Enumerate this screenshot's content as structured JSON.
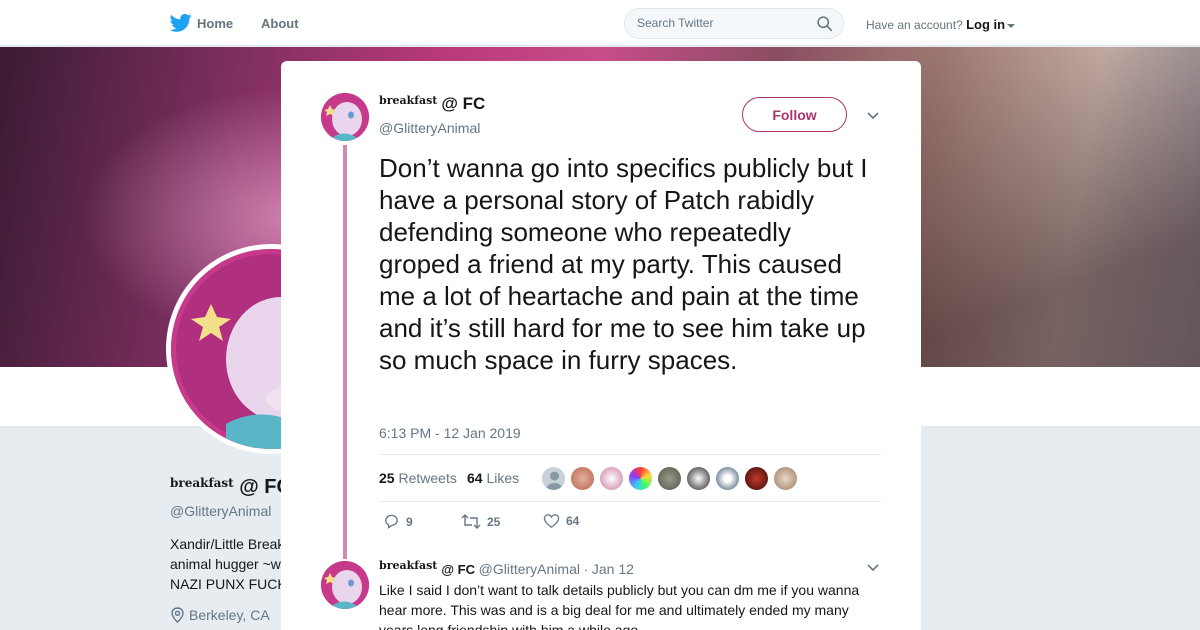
{
  "nav": {
    "home_label": "Home",
    "about_label": "About",
    "search_placeholder": "Search Twitter",
    "account_prompt": "Have an account?",
    "login_label": "Log in"
  },
  "profile": {
    "name_prefix": "breakfast",
    "name_main": "@ FC",
    "handle": "@GlitteryAnimal",
    "bio_lines": [
      "Xandir/Little Break",
      "animal hugger ~w",
      "NAZI PUNX FUCK"
    ],
    "location": "Berkeley, CA"
  },
  "tweet": {
    "name_prefix": "breakfast",
    "name_main": "@ FC",
    "handle": "@GlitteryAnimal",
    "follow_label": "Follow",
    "text": "Don’t wanna go into specifics publicly but I have a personal story of Patch rabidly defending someone who repeatedly groped a friend at my party. This caused me a lot of heartache and pain at the time and it’s still hard for me to see him take up so much space in furry spaces.",
    "timestamp": "6:13 PM - 12 Jan 2019",
    "retweets_count": "25",
    "retweets_label": "Retweets",
    "likes_count": "64",
    "likes_label": "Likes",
    "actions": {
      "replies": "9",
      "retweets": "25",
      "likes": "64"
    }
  },
  "reply": {
    "name_prefix": "breakfast",
    "name_main": "@ FC",
    "handle": "@GlitteryAnimal",
    "separator": "·",
    "date": "Jan 12",
    "text": "Like I said I don’t want to talk details publicly but you can dm me if you wanna hear more. This was and is a big deal for me and ultimately ended my many years long friendship with him a while ago."
  },
  "colors": {
    "accent": "#a8366e",
    "twitter_blue": "#1da1f2",
    "thread_line": "#d08ab0",
    "muted": "#657786"
  }
}
